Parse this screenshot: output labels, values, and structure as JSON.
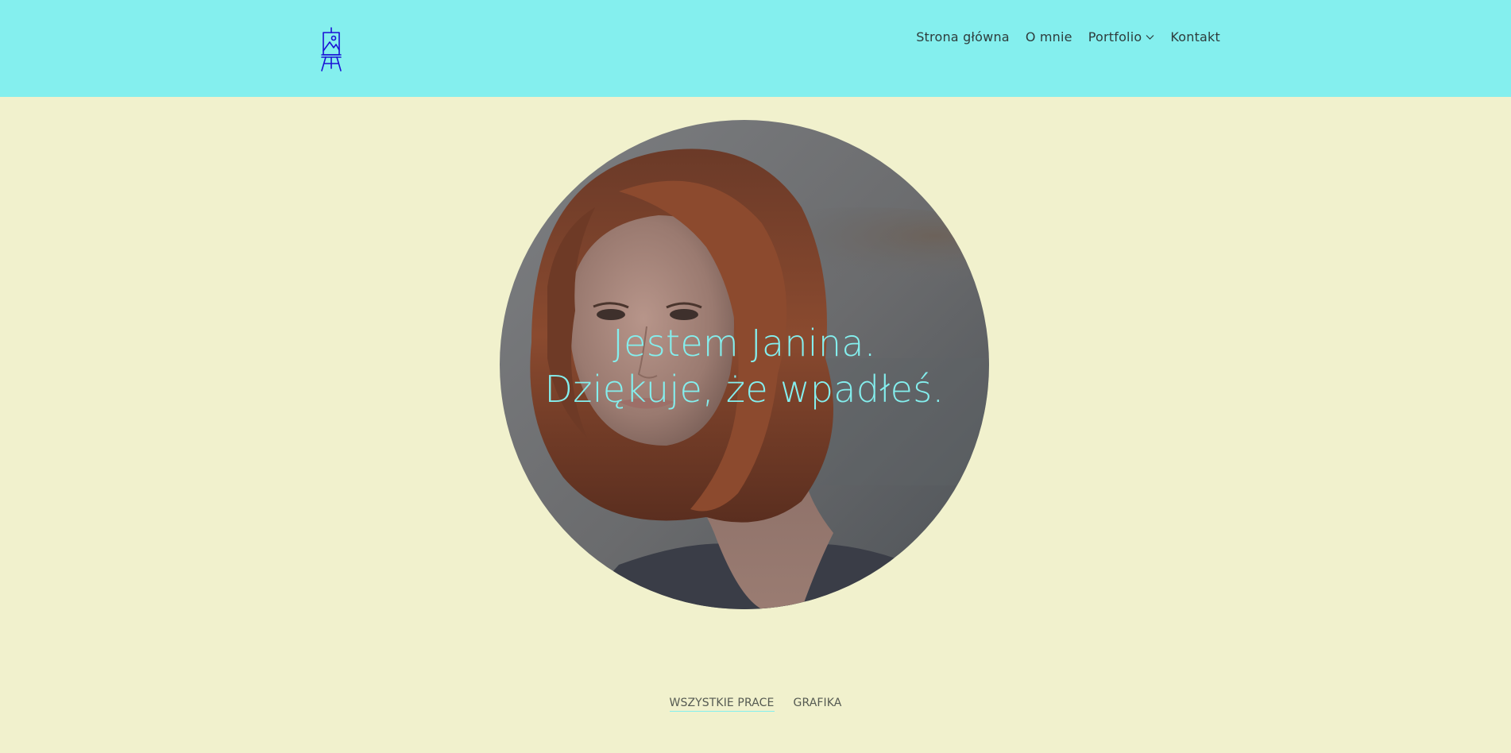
{
  "colors": {
    "header_bg": "#84efee",
    "page_bg": "#f1f1cd",
    "accent": "#84efee",
    "logo": "#1b12d6",
    "nav_text": "#2e3c3c"
  },
  "header": {
    "logo_icon": "easel-icon",
    "nav": [
      {
        "label": "Strona główna"
      },
      {
        "label": "O mnie"
      },
      {
        "label": "Portfolio",
        "has_dropdown": true,
        "icon": "chevron-down-icon"
      },
      {
        "label": "Kontakt"
      }
    ]
  },
  "hero": {
    "line1": "Jestem Janina.",
    "line2": "Dziękuje, że wpadłeś."
  },
  "filters": [
    {
      "label": "WSZYSTKIE PRACE",
      "active": true
    },
    {
      "label": "GRAFIKA",
      "active": false
    }
  ]
}
